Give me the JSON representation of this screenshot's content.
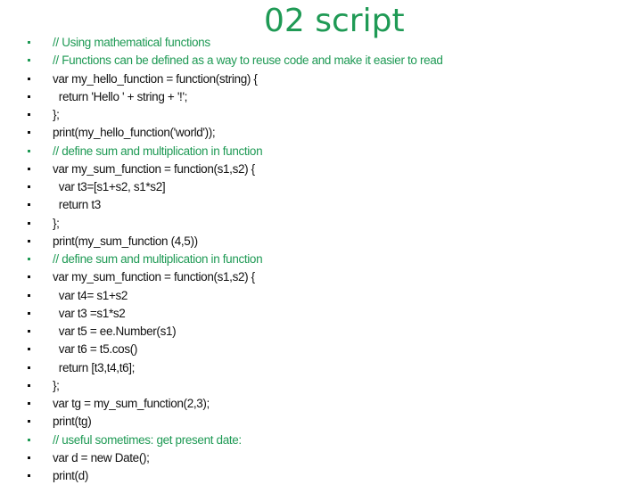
{
  "slide": {
    "title": "02 script",
    "accent_color": "#1f9a55",
    "lines": [
      {
        "text": "// Using mathematical functions",
        "kind": "comment"
      },
      {
        "text": "// Functions can be defined as a way to reuse code and make it easier to read",
        "kind": "comment"
      },
      {
        "text": "var my_hello_function = function(string) {",
        "kind": "code"
      },
      {
        "text": "  return 'Hello ' + string + '!';",
        "kind": "code"
      },
      {
        "text": "};",
        "kind": "code"
      },
      {
        "text": "print(my_hello_function('world'));",
        "kind": "code"
      },
      {
        "text": "// define sum and multiplication in function",
        "kind": "comment"
      },
      {
        "text": "var my_sum_function = function(s1,s2) {",
        "kind": "code"
      },
      {
        "text": "  var t3=[s1+s2, s1*s2]",
        "kind": "code"
      },
      {
        "text": "  return t3",
        "kind": "code"
      },
      {
        "text": "};",
        "kind": "code"
      },
      {
        "text": "print(my_sum_function (4,5))",
        "kind": "code"
      },
      {
        "text": "// define sum and multiplication in function",
        "kind": "comment"
      },
      {
        "text": "var my_sum_function = function(s1,s2) {",
        "kind": "code"
      },
      {
        "text": "  var t4= s1+s2",
        "kind": "code"
      },
      {
        "text": "  var t3 =s1*s2",
        "kind": "code"
      },
      {
        "text": "  var t5 = ee.Number(s1)",
        "kind": "code"
      },
      {
        "text": "  var t6 = t5.cos()",
        "kind": "code"
      },
      {
        "text": "  return [t3,t4,t6];",
        "kind": "code"
      },
      {
        "text": "};",
        "kind": "code"
      },
      {
        "text": "var tg = my_sum_function(2,3);",
        "kind": "code"
      },
      {
        "text": "print(tg)",
        "kind": "code"
      },
      {
        "text": "// useful sometimes: get present date:",
        "kind": "comment"
      },
      {
        "text": "var d = new Date();",
        "kind": "code"
      },
      {
        "text": "print(d)",
        "kind": "code"
      }
    ]
  }
}
